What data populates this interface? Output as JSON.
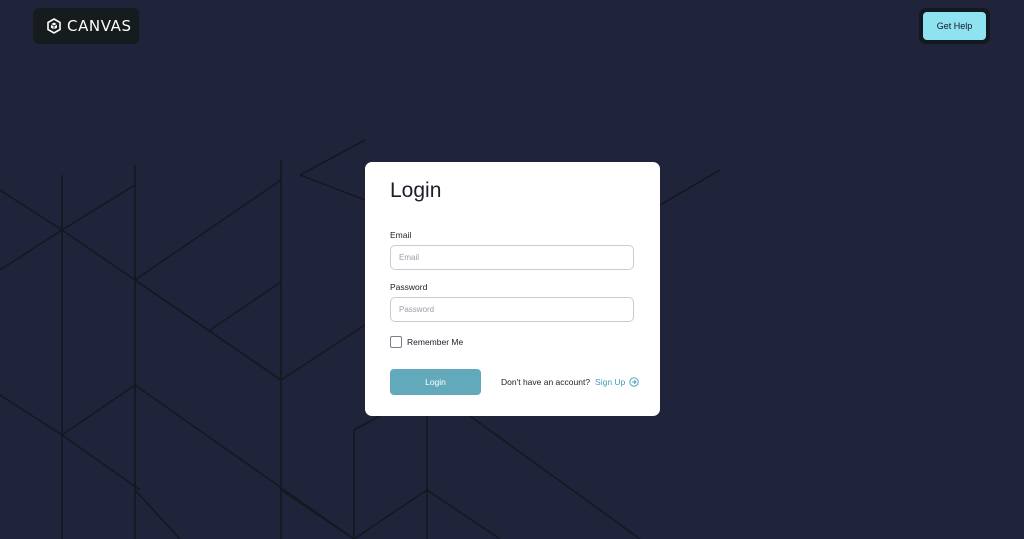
{
  "header": {
    "logo_text": "CANVAS",
    "logo_icon": "hexagon-cube-icon",
    "help_label": "Get Help"
  },
  "login": {
    "title": "Login",
    "email_label": "Email",
    "email_placeholder": "Email",
    "email_value": "",
    "password_label": "Password",
    "password_placeholder": "Password",
    "password_value": "",
    "remember_label": "Remember Me",
    "remember_checked": false,
    "login_label": "Login",
    "signup_prompt": "Don't have an account?",
    "signup_link": "Sign Up",
    "signup_icon": "circle-arrow-right-icon"
  },
  "colors": {
    "background": "#20243a",
    "pattern_lines": "#15181f",
    "accent_button": "#62a9bb",
    "help_button": "#8fe3f0",
    "link": "#3e9bb8"
  }
}
